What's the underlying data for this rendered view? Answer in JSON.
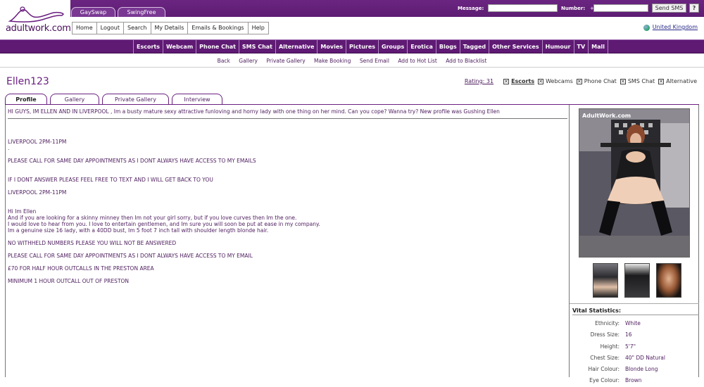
{
  "logo": {
    "text": "adultwork.com"
  },
  "top_tabs": [
    "GaySwap",
    "SwingFree"
  ],
  "sms": {
    "message_label": "Message:",
    "number_label": "Number:",
    "number_prefix": "+",
    "send_label": "Send SMS",
    "help_label": "?"
  },
  "main_nav": [
    "Home",
    "Logout",
    "Search",
    "My Details",
    "Emails & Bookings",
    "Help"
  ],
  "country": "United Kingdom",
  "categories": [
    "Escorts",
    "Webcam",
    "Phone Chat",
    "SMS Chat",
    "Alternative",
    "Movies",
    "Pictures",
    "Groups",
    "Erotica",
    "Blogs",
    "Tagged",
    "Other Services",
    "Humour",
    "TV",
    "Mall"
  ],
  "sub_nav": [
    "Back",
    "Gallery",
    "Private Gallery",
    "Make Booking",
    "Send Email",
    "Add to Hot List",
    "Add to Blacklist"
  ],
  "profile": {
    "username": "Ellen123",
    "rating": "Rating: 31",
    "services": [
      "Escorts",
      "Webcams",
      "Phone Chat",
      "SMS Chat",
      "Alternative"
    ]
  },
  "profile_tabs": [
    "Profile",
    "Gallery",
    "Private Gallery",
    "Interview"
  ],
  "intro": "HI GUYS, IM ELLEN AND IN LIVERPOOL , Im a busty mature sexy attractive funloving and horny lady with one thing on her mind. Can you cope? Wanna try? New profile was Gushing Ellen",
  "body": [
    {
      "text": "LIVERPOOL 2PM-11PM\n."
    },
    {
      "text": "PLEASE CALL FOR SAME DAY APPOINTMENTS AS I DONT ALWAYS HAVE ACCESS TO MY EMAILS"
    },
    {
      "text": "IF I DONT ANSWER PLEASE FEEL FREE TO TEXT AND I WILL GET BACK TO YOU"
    },
    {
      "text": "LIVERPOOL 2PM-11PM"
    },
    {
      "text": "Hi Im Ellen\nAnd if you are looking for a skinny minney then Im not your girl sorry, but if you love curves then Im the one.\nI would love to hear from you. I love to entertain gentlemen, and Im sure you will soon be put at ease in my company.\nIm a genuine size 16 lady, with a 40DD bust, Im 5 foot 7 inch tall with shoulder length blonde hair."
    },
    {
      "text": "NO WITHHELD NUMBERS PLEASE YOU WILL NOT BE ANSWERED"
    },
    {
      "text": "PLEASE CALL FOR SAME DAY APPOINTMENTS AS I DONT ALWAYS HAVE ACCESS TO MY EMAIL"
    },
    {
      "text": "£70 FOR HALF HOUR OUTCALLS IN THE PRESTON AREA"
    },
    {
      "text": "MINIMUM 1 HOUR OUTCALL OUT OF PRESTON"
    }
  ],
  "photo_watermark": "AdultWork.com",
  "vital_stats": {
    "heading": "Vital Statistics:",
    "rows": [
      {
        "k": "Ethnicity:",
        "v": "White"
      },
      {
        "k": "Dress Size:",
        "v": "16"
      },
      {
        "k": "Height:",
        "v": "5'7\""
      },
      {
        "k": "Chest Size:",
        "v": "40\" DD Natural"
      },
      {
        "k": "Hair Colour:",
        "v": "Blonde Long"
      },
      {
        "k": "Eye Colour:",
        "v": "Brown"
      }
    ]
  }
}
